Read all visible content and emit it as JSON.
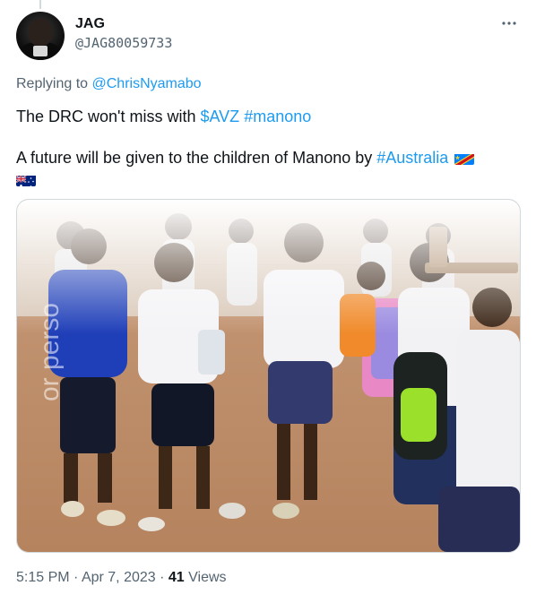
{
  "author": {
    "name": "JAG",
    "handle": "@JAG80059733"
  },
  "more_menu_icon": "more-horizontal-icon",
  "reply_context": {
    "prefix": "Replying to",
    "mention": "@ChrisNyamabo"
  },
  "tweet": {
    "line1_text": "The DRC won't miss with ",
    "line1_cashtag": "$AVZ",
    "line1_hashtag": "#manono",
    "line2_text": "A future will be given to the children of Manono by ",
    "line2_hashtag": "#Australia",
    "flags": [
      "flag-drc-icon",
      "flag-australia-icon"
    ]
  },
  "photo": {
    "watermark": "or perso"
  },
  "meta": {
    "time": "5:15 PM",
    "separator": " · ",
    "date": "Apr 7, 2023",
    "views_count": "41",
    "views_label": "Views"
  },
  "colors": {
    "link": "#1d9bf0",
    "secondary_text": "#536471",
    "primary_text": "#0f1419",
    "border": "#cfd9de"
  }
}
